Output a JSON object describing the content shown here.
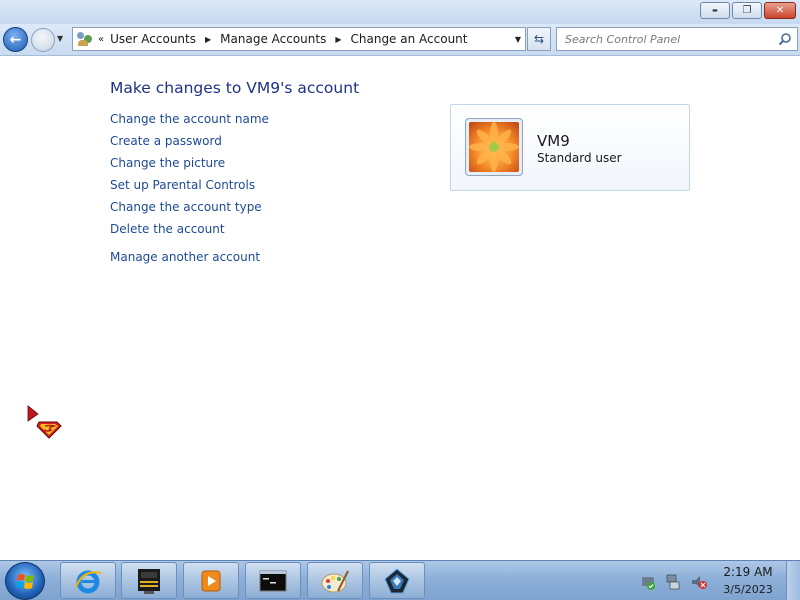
{
  "window": {
    "caption_buttons": [
      {
        "name": "minimize",
        "icon": "minimize-icon",
        "glyph": "▬"
      },
      {
        "name": "maximize",
        "icon": "restore-icon",
        "glyph": "❐"
      },
      {
        "name": "close",
        "icon": "close-icon",
        "glyph": "✕"
      }
    ]
  },
  "navbar": {
    "back_glyph": "←",
    "recent_glyph": "▼",
    "address": {
      "chevron": "«",
      "breadcrumbs": [
        "User Accounts",
        "Manage Accounts",
        "Change an Account"
      ],
      "separator": "▶",
      "dropdown_glyph": "▼"
    },
    "refresh_glyph": "⇆",
    "search": {
      "placeholder": "Search Control Panel"
    }
  },
  "main": {
    "title": "Make changes to VM9's account",
    "tasks": [
      "Change the account name",
      "Create a password",
      "Change the picture",
      "Set up Parental Controls",
      "Change the account type",
      "Delete the account"
    ],
    "other_task": "Manage another account",
    "account": {
      "name": "VM9",
      "type": "Standard user"
    }
  },
  "taskbar": {
    "pinned": [
      {
        "name": "internet-explorer",
        "icon": "internet-explorer-icon"
      },
      {
        "name": "app-cm",
        "icon": "cm-app-icon"
      },
      {
        "name": "media-player",
        "icon": "media-player-icon"
      },
      {
        "name": "command-prompt",
        "icon": "command-prompt-icon"
      },
      {
        "name": "paint",
        "icon": "paint-icon"
      },
      {
        "name": "app-dark",
        "icon": "dark-app-icon"
      }
    ],
    "clock": {
      "time": "2:19 AM",
      "date": "3/5/2023"
    }
  },
  "colors": {
    "link": "#1e4a96",
    "title": "#1e3287",
    "taskbar": "#8db0d8"
  }
}
